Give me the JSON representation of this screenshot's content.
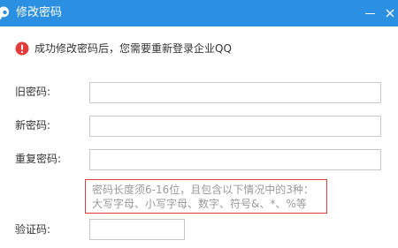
{
  "window": {
    "title": "修改密码",
    "titlebar_color": "#2b8fe2",
    "app_icon": "qq-logo-icon",
    "minimize_icon": "minimize-icon",
    "close_icon": "close-icon"
  },
  "notice": {
    "icon": "warning-circle-icon",
    "icon_color": "#e33b3b",
    "text": "成功修改密码后，您需要重新登录企业QQ"
  },
  "form": {
    "old_password": {
      "label": "旧密码:",
      "value": ""
    },
    "new_password": {
      "label": "新密码:",
      "value": ""
    },
    "confirm_password": {
      "label": "重复密码:",
      "value": ""
    },
    "captcha": {
      "label": "验证码:",
      "value": ""
    }
  },
  "hint": {
    "border_color": "#e33b3b",
    "line1": "密码长度须6-16位，且包含以下情况中的3种：",
    "line2": "大写字母、小写字母、数字、符号&、*、%等"
  }
}
